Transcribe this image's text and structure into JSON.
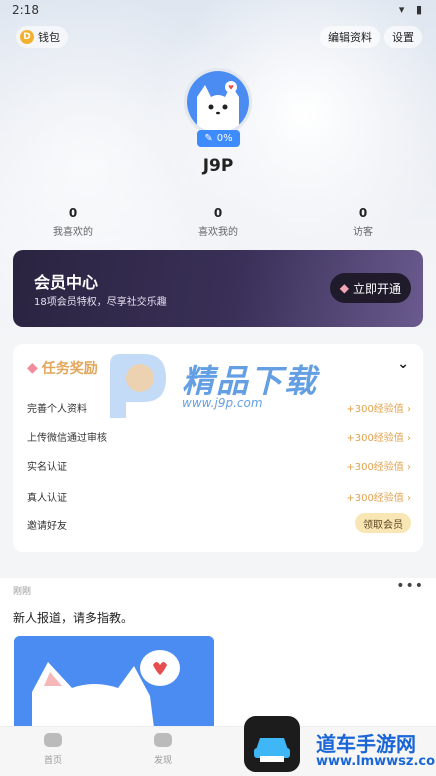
{
  "status": {
    "time": "2:18",
    "icons": "▾ ▮"
  },
  "topbar": {
    "wallet_label": "钱包",
    "coin_letter": "D",
    "edit_label": "编辑资料",
    "settings_label": "设置"
  },
  "profile": {
    "progress": "0%",
    "username": "J9P"
  },
  "stats": [
    {
      "value": "0",
      "label": "我喜欢的"
    },
    {
      "value": "0",
      "label": "喜欢我的"
    },
    {
      "value": "0",
      "label": "访客"
    }
  ],
  "vip": {
    "title": "会员中心",
    "subtitle": "18项会员特权，尽享社交乐趣",
    "button": "立即开通"
  },
  "tasks": {
    "title": "任务奖励",
    "items": [
      {
        "name": "完善个人资料",
        "reward": "+300经验值 ›"
      },
      {
        "name": "上传微信通过审核",
        "reward": "+300经验值 ›"
      },
      {
        "name": "实名认证",
        "reward": "+300经验值 ›"
      },
      {
        "name": "真人认证",
        "reward": "+300经验值 ›"
      },
      {
        "name": "邀请好友",
        "reward": "领取会员"
      }
    ]
  },
  "watermark": {
    "title": "精品下载",
    "url": "www.j9p.com"
  },
  "feed": {
    "time": "刚刚",
    "more": "•••",
    "text": "新人报道，请多指教。"
  },
  "tabs": [
    {
      "label": "首页"
    },
    {
      "label": "发现"
    }
  ],
  "corner": {
    "title": "道车手游网",
    "url": "www.lmwwsz.com"
  },
  "colors": {
    "accent": "#3d8bfd",
    "reward": "#e1a24d",
    "vip_bg": "#2a2440"
  }
}
